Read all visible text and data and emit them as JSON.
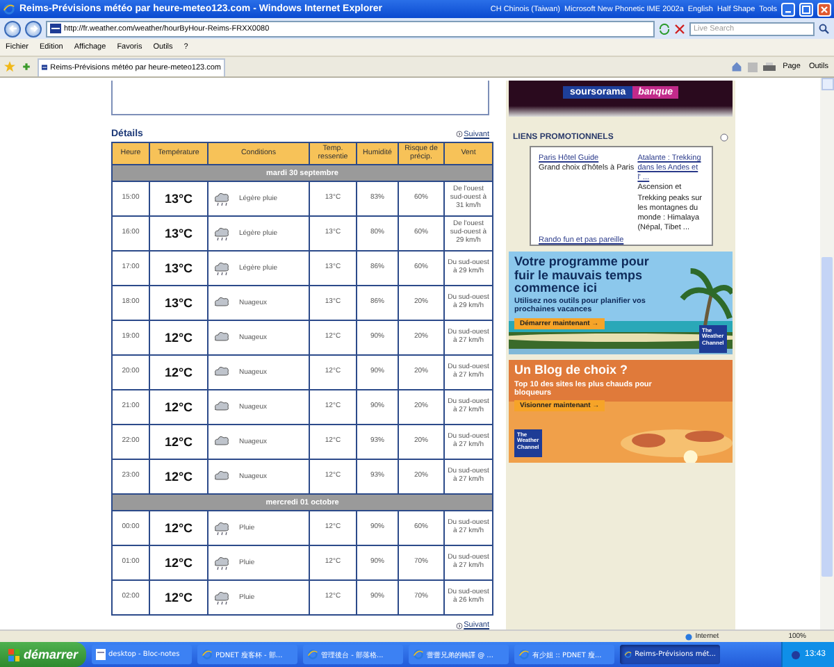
{
  "window": {
    "title": "Reims-Prévisions météo par heure-meteo123.com - Windows Internet Explorer"
  },
  "language_bar": [
    "CH Chinois (Taiwan)",
    "Microsoft New Phonetic IME 2002a",
    "English",
    "Half Shape",
    "Tools"
  ],
  "address_bar": {
    "url": "http://fr.weather.com/weather/hourByHour-Reims-FRXX0080"
  },
  "search": {
    "placeholder": "Live Search"
  },
  "menu": [
    "Fichier",
    "Edition",
    "Affichage",
    "Favoris",
    "Outils",
    "?"
  ],
  "tab": {
    "title": "Reims-Prévisions météo par heure-meteo123.com"
  },
  "command_bar": [
    "Page",
    "Outils"
  ],
  "details": {
    "title": "Détails",
    "next_top": "Suivant",
    "next_bottom": "Suivant",
    "columns": [
      "Heure",
      "Température",
      "Conditions",
      "Temp. ressentie",
      "Humidité",
      "Risque de précip.",
      "Vent"
    ],
    "rows": [
      {
        "kind": "day",
        "label": "mardi 30 septembre"
      },
      {
        "kind": "rain",
        "time": "15:00",
        "temp": "13°C",
        "conditions": "Légère pluie",
        "feels": "13°C",
        "humidity": "83%",
        "precip": "60%",
        "wind": "De l'ouest sud-ouest à 31 km/h"
      },
      {
        "kind": "rain",
        "time": "16:00",
        "temp": "13°C",
        "conditions": "Légère pluie",
        "feels": "13°C",
        "humidity": "80%",
        "precip": "60%",
        "wind": "De l'ouest sud-ouest à 29 km/h"
      },
      {
        "kind": "rain",
        "time": "17:00",
        "temp": "13°C",
        "conditions": "Légère pluie",
        "feels": "13°C",
        "humidity": "86%",
        "precip": "60%",
        "wind": "Du sud-ouest à 29 km/h"
      },
      {
        "kind": "cloud",
        "time": "18:00",
        "temp": "13°C",
        "conditions": "Nuageux",
        "feels": "13°C",
        "humidity": "86%",
        "precip": "20%",
        "wind": "Du sud-ouest à 29 km/h"
      },
      {
        "kind": "cloud",
        "time": "19:00",
        "temp": "12°C",
        "conditions": "Nuageux",
        "feels": "12°C",
        "humidity": "90%",
        "precip": "20%",
        "wind": "Du sud-ouest à 27 km/h"
      },
      {
        "kind": "cloud",
        "time": "20:00",
        "temp": "12°C",
        "conditions": "Nuageux",
        "feels": "12°C",
        "humidity": "90%",
        "precip": "20%",
        "wind": "Du sud-ouest à 27 km/h"
      },
      {
        "kind": "cloud",
        "time": "21:00",
        "temp": "12°C",
        "conditions": "Nuageux",
        "feels": "12°C",
        "humidity": "90%",
        "precip": "20%",
        "wind": "Du sud-ouest à 27 km/h"
      },
      {
        "kind": "cloud",
        "time": "22:00",
        "temp": "12°C",
        "conditions": "Nuageux",
        "feels": "12°C",
        "humidity": "93%",
        "precip": "20%",
        "wind": "Du sud-ouest à 27 km/h"
      },
      {
        "kind": "cloud",
        "time": "23:00",
        "temp": "12°C",
        "conditions": "Nuageux",
        "feels": "12°C",
        "humidity": "93%",
        "precip": "20%",
        "wind": "Du sud-ouest à 27 km/h"
      },
      {
        "kind": "day",
        "label": "mercredi 01 octobre"
      },
      {
        "kind": "rain",
        "time": "00:00",
        "temp": "12°C",
        "conditions": "Pluie",
        "feels": "12°C",
        "humidity": "90%",
        "precip": "60%",
        "wind": "Du sud-ouest à 27 km/h"
      },
      {
        "kind": "rain",
        "time": "01:00",
        "temp": "12°C",
        "conditions": "Pluie",
        "feels": "12°C",
        "humidity": "90%",
        "precip": "70%",
        "wind": "Du sud-ouest à 27 km/h"
      },
      {
        "kind": "rain",
        "time": "02:00",
        "temp": "12°C",
        "conditions": "Pluie",
        "feels": "12°C",
        "humidity": "90%",
        "precip": "70%",
        "wind": "Du sud-ouest à 26 km/h"
      }
    ]
  },
  "sidebar": {
    "bank_logo": [
      "soursorama",
      "banque"
    ],
    "promo_title": "LIENS PROMOTIONNELS",
    "promo_ads": [
      {
        "link": "Paris Hôtel Guide",
        "text": "Grand choix d'hôtels à Paris"
      },
      {
        "link": "Atalante : Trekking dans les Andes et l' ...",
        "text": "Ascension et Trekking peaks sur les montagnes du monde : Himalaya (Népal, Tibet ..."
      }
    ],
    "promo_more": "Rando fun et pas pareille",
    "banners": [
      {
        "kind": "beach",
        "headline": "Votre programme pour fuir le mauvais temps commence ici",
        "subline": "Utilisez nos outils pour planifier vos prochaines vacances",
        "button": "Démarrer maintenant →",
        "brand": "The Weather Channel"
      },
      {
        "kind": "sunset",
        "headline": "Un Blog de choix ?",
        "subline": "Top 10 des sites les plus chauds pour bloqueurs",
        "button": "Visionner maintenant →",
        "brand": "The Weather Channel"
      }
    ]
  },
  "status_bar": {
    "zone": "Internet",
    "zoom": "100%"
  },
  "taskbar": {
    "start": "démarrer",
    "items": [
      {
        "kind": "notepad",
        "label": "desktop - Bloc-notes",
        "selected": false
      },
      {
        "kind": "browser",
        "label": "PDNET 瘦客杯 - 部...",
        "selected": false
      },
      {
        "kind": "browser",
        "label": "管理後台 - 部落格...",
        "selected": false
      },
      {
        "kind": "browser",
        "label": "蕾蕾兄弟的轉譯 @ ...",
        "selected": false
      },
      {
        "kind": "browser",
        "label": "有少姐 :: PDNET 瘦...",
        "selected": false
      },
      {
        "kind": "browser",
        "label": "Reims-Prévisions mét...",
        "selected": true
      }
    ],
    "clock": "13:43"
  }
}
